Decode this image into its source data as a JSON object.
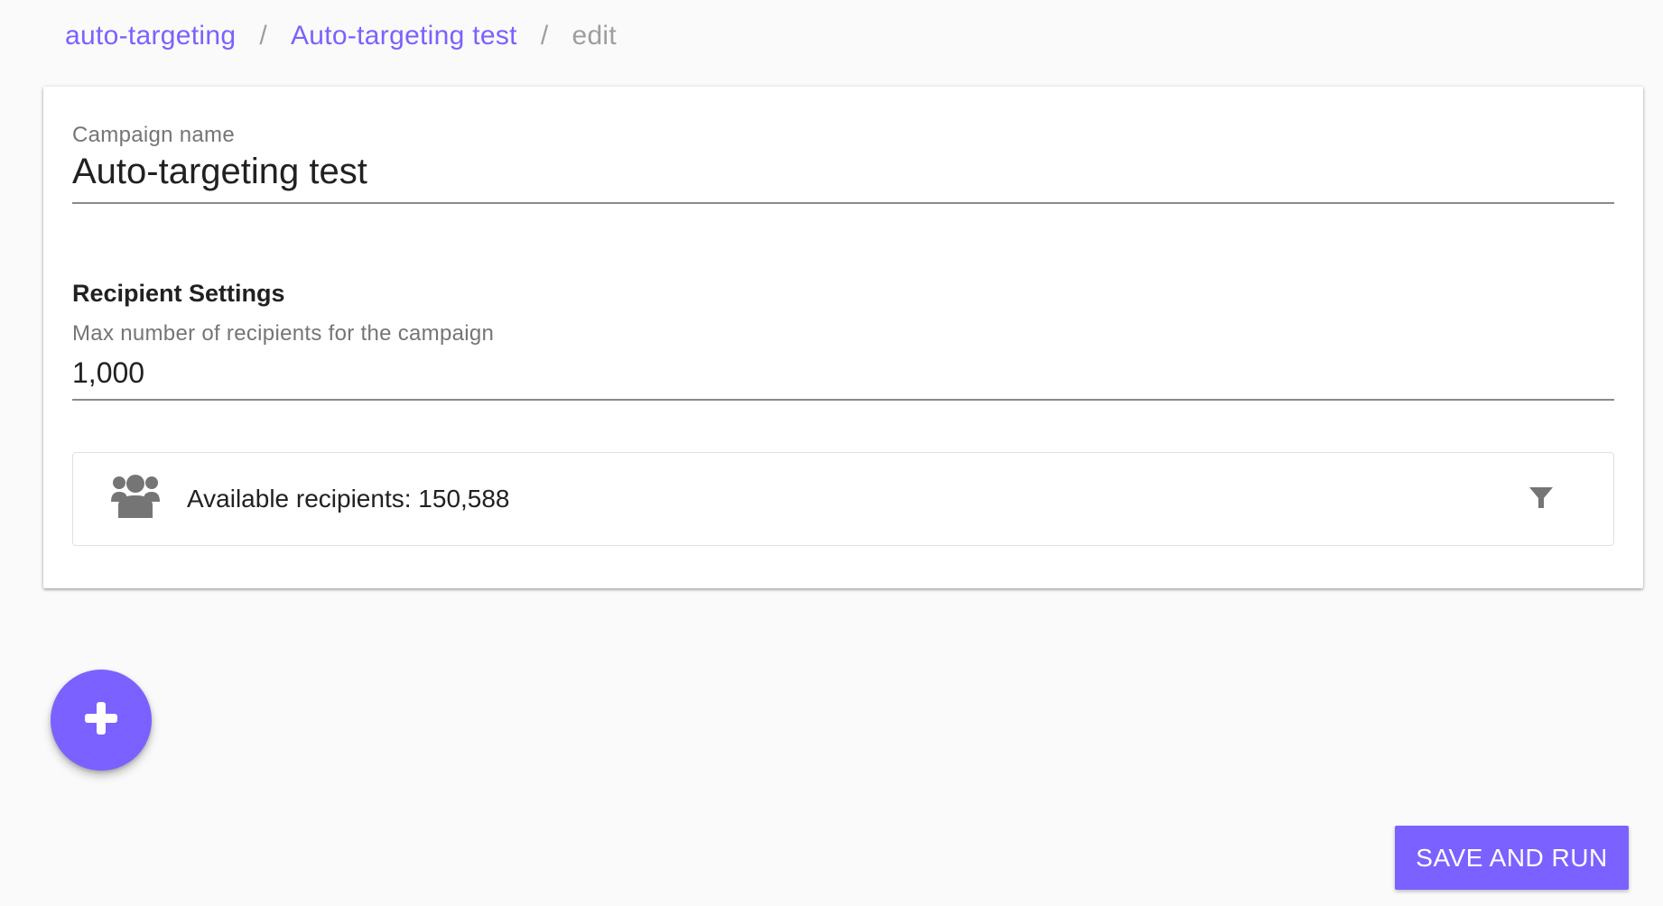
{
  "breadcrumb": {
    "items": [
      {
        "label": "auto-targeting"
      },
      {
        "label": "Auto-targeting test"
      },
      {
        "label": "edit"
      }
    ],
    "separator": "/"
  },
  "campaign": {
    "name_label": "Campaign name",
    "name_value": "Auto-targeting test"
  },
  "recipient_settings": {
    "title": "Recipient Settings",
    "max_label": "Max number of recipients for the campaign",
    "max_value": "1,000",
    "available_text": "Available recipients: 150,588",
    "group_icon": "group-icon",
    "filter_icon": "filter-icon"
  },
  "fab": {
    "icon": "plus-icon"
  },
  "actions": {
    "save_and_run": "SAVE AND RUN"
  },
  "colors": {
    "accent": "#7b61ff",
    "background": "#fafafa",
    "icon_gray": "#757575"
  }
}
